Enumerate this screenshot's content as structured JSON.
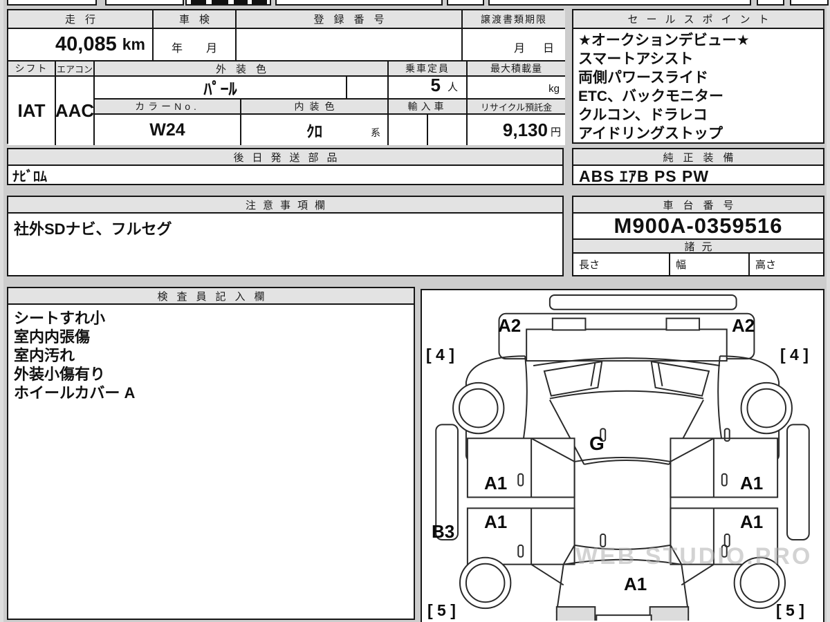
{
  "top_table": {
    "mileage_label": "走行",
    "mileage_value": "40,085",
    "mileage_unit": "km",
    "inspection_label": "車検",
    "inspection_year": "年",
    "inspection_month": "月",
    "registration_label": "登録番号",
    "registration_value": "",
    "deadline_label": "譲渡書類期限",
    "deadline_month": "月",
    "deadline_day": "日"
  },
  "spec_table": {
    "shift_label": "シフト",
    "shift_value": "IAT",
    "aircon_label": "エアコン",
    "aircon_value": "AAC",
    "exterior_color_label": "外装色",
    "exterior_color_value": "ﾊﾟｰﾙ",
    "capacity_label": "乗車定員",
    "capacity_value": "5",
    "capacity_unit": "人",
    "max_load_label": "最大積載量",
    "max_load_unit": "kg",
    "color_no_label": "カラーNo.",
    "color_no_value": "W24",
    "interior_color_label": "内装色",
    "interior_color_value": "ｸﾛ",
    "interior_color_suffix": "系",
    "import_label": "輸入車",
    "recycle_label": "リサイクル預託金",
    "recycle_value": "9,130",
    "recycle_unit": "円"
  },
  "sales_points": {
    "title": "セールスポイント",
    "lines": [
      "★オークションデビュー★",
      "スマートアシスト",
      "両側パワースライド",
      "ETC、バックモニター",
      "クルコン、ドラレコ",
      "アイドリングストップ"
    ]
  },
  "later_parts": {
    "title": "後日発送部品",
    "value": "ﾅﾋﾞﾛﾑ"
  },
  "genuine_equipment": {
    "title": "純正装備",
    "value": "ABS ｴｱB PS PW"
  },
  "notes": {
    "title": "注意事項欄",
    "value": "社外SDナビ、フルセグ"
  },
  "chassis": {
    "title": "車台番号",
    "value": "M900A-0359516"
  },
  "dimensions": {
    "title": "諸元",
    "length_label": "長さ",
    "width_label": "幅",
    "height_label": "高さ"
  },
  "inspector_notes": {
    "title": "検査員記入欄",
    "lines": [
      "シートすれ小",
      "室内内張傷",
      "室内汚れ",
      "外装小傷有り",
      "ホイールカバー A"
    ]
  },
  "diagram": {
    "labels": [
      {
        "text": "A2"
      },
      {
        "text": "A2"
      },
      {
        "text": "[ 4 ]"
      },
      {
        "text": "[ 4 ]"
      },
      {
        "text": "G"
      },
      {
        "text": "A1"
      },
      {
        "text": "A1"
      },
      {
        "text": "A1"
      },
      {
        "text": "A1"
      },
      {
        "text": "B3"
      },
      {
        "text": "A1"
      },
      {
        "text": "[ 5 ]"
      },
      {
        "text": "[ 5 ]"
      }
    ],
    "watermark": "WEB STUDIO.PRO"
  },
  "colors": {
    "border": "#151515",
    "header_bg": "#e3e3e3",
    "page_bg": "#cdcdcd",
    "watermark": "#afafaf"
  }
}
